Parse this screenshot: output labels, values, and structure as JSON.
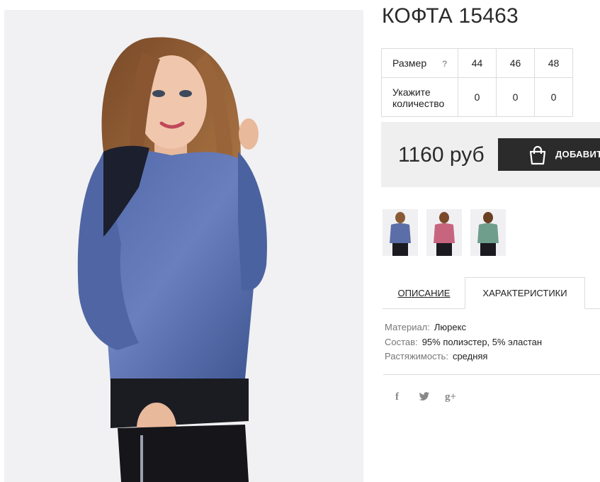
{
  "product": {
    "title": "КОФТА 15463",
    "image_alt": "Model wearing blue lurex top with black lace shoulders"
  },
  "sizes": {
    "size_label": "Размер",
    "help": "?",
    "values": [
      "44",
      "46",
      "48"
    ],
    "qty_label_line1": "Укажите",
    "qty_label_line2": "количество",
    "quantities": [
      "0",
      "0",
      "0"
    ]
  },
  "purchase": {
    "price": "1160 руб",
    "add_button_label": "ДОБАВИТЬ"
  },
  "thumbnails": [
    {
      "color": "blue",
      "hex": "#5b6ea8"
    },
    {
      "color": "pink",
      "hex": "#c7657f"
    },
    {
      "color": "green",
      "hex": "#6f9e8c"
    }
  ],
  "tabs": {
    "description": "ОПИСАНИЕ",
    "characteristics": "ХАРАКТЕРИСТИКИ",
    "active": "characteristics"
  },
  "characteristics": [
    {
      "key": "Материал:",
      "value": "Люрекс"
    },
    {
      "key": "Состав:",
      "value": "95% полиэстер, 5% эластан"
    },
    {
      "key": "Растяжимость:",
      "value": "средняя"
    }
  ],
  "social": {
    "facebook": "f",
    "twitter": "🐦",
    "googleplus": "g+"
  }
}
